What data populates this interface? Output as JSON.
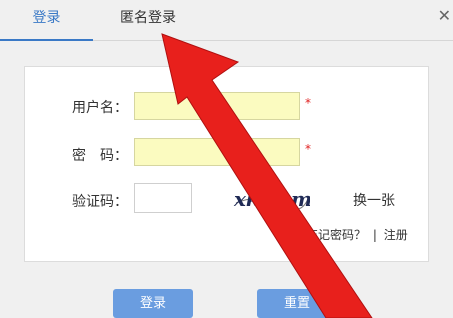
{
  "tabs": [
    {
      "label": "登录",
      "active": true
    },
    {
      "label": "匿名登录",
      "active": false
    }
  ],
  "close_glyph": "✕",
  "form": {
    "username_label": "用户名：",
    "password_label": "密　码：",
    "captcha_label": "验证码：",
    "required_mark": "*",
    "captcha_text": "xkwgm",
    "refresh_label": "换一张",
    "forgot_label": "忘记密码？",
    "separator": "|",
    "register_label": "注册"
  },
  "buttons": {
    "login_label": "登录",
    "reset_label": "重置"
  },
  "colors": {
    "accent": "#3a79c6",
    "button": "#6a9de0",
    "field_bg": "#fbfbc0",
    "required": "#e02020",
    "annotation_arrow": "#e8201c"
  }
}
